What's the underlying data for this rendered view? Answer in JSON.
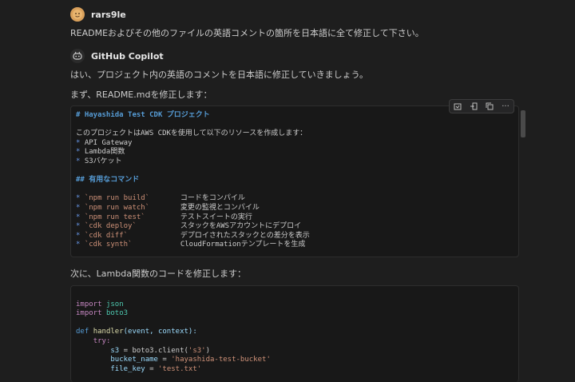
{
  "user": {
    "name": "rars9le",
    "message": "READMEおよびその他のファイルの英語コメントの箇所を日本語に全て修正して下さい。"
  },
  "copilot": {
    "name": "GitHub Copilot",
    "intro": "はい、プロジェクト内の英語のコメントを日本語に修正していきましょう。",
    "readme_text": "まず、README.mdを修正します：",
    "lambda_text": "次に、Lambda関数のコードを修正します："
  },
  "toolbar": {
    "icons": [
      "apply-icon",
      "insert-icon",
      "copy-icon",
      "more-icon"
    ],
    "more_label": "···"
  },
  "readme_code": {
    "title": "# Hayashida Test CDK プロジェクト",
    "desc": "このプロジェクトはAWS CDKを使用して以下のリソースを作成します：",
    "bullets": [
      "API Gateway",
      "Lambda関数",
      "S3バケット"
    ],
    "cmd_heading": "## 有用なコマンド",
    "commands": [
      {
        "cmd": "`npm run build`",
        "desc": "コードをコンパイル"
      },
      {
        "cmd": "`npm run watch`",
        "desc": "変更の監視とコンパイル"
      },
      {
        "cmd": "`npm run test`",
        "desc": "テストスイートの実行"
      },
      {
        "cmd": "`cdk deploy`",
        "desc": "スタックをAWSアカウントにデプロイ"
      },
      {
        "cmd": "`cdk diff`",
        "desc": "デプロイされたスタックとの差分を表示"
      },
      {
        "cmd": "`cdk synth`",
        "desc": "CloudFormationテンプレートを生成"
      }
    ]
  },
  "lambda_code": {
    "import1_kw": "import",
    "import1_mod": "json",
    "import2_kw": "import",
    "import2_mod": "boto3",
    "def_kw": "def",
    "func": "handler",
    "params": "(event, context):",
    "try_kw": "try:",
    "s3_var": "s3",
    "s3_rhs": "= boto3.client(",
    "s3_arg": "'s3'",
    "s3_close": ")",
    "bucket_var": "bucket_name",
    "eq": "=",
    "bucket_val": "'hayashida-test-bucket'",
    "key_var": "file_key",
    "key_val": "'test.txt'"
  }
}
